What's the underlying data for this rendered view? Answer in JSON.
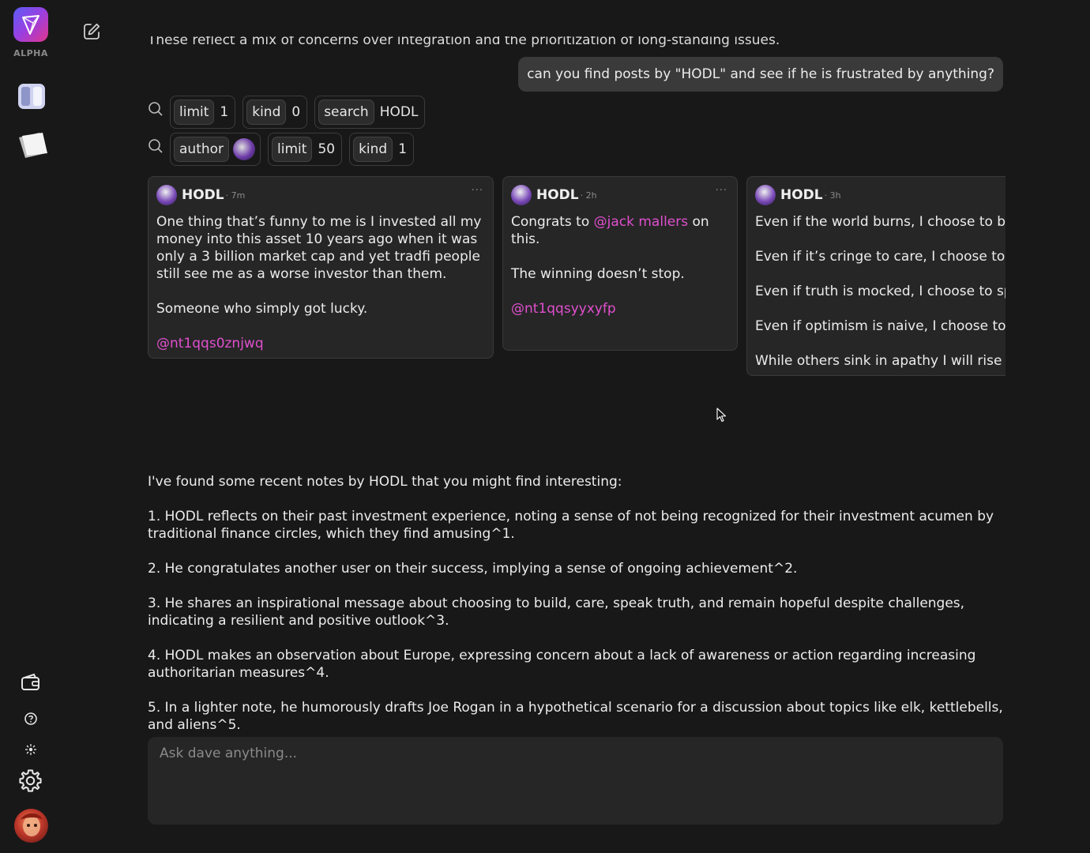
{
  "sidebar": {
    "logo_label": "ALPHA",
    "icons": [
      "app-logo-icon",
      "sidebar-toggle-icon",
      "notes-icon",
      "wallet-icon",
      "help-icon",
      "theme-icon",
      "settings-icon"
    ]
  },
  "conversation": {
    "previous_reply_tail": "These reflect a mix of concerns over integration and the prioritization of long-standing issues.",
    "user_message": "can you find posts by \"HODL\" and see if he is frustrated by anything?"
  },
  "tool_calls": [
    {
      "chips": [
        {
          "key": "limit",
          "value": "1"
        },
        {
          "key": "kind",
          "value": "0"
        },
        {
          "key": "search",
          "value": "HODL"
        }
      ]
    },
    {
      "chips": [
        {
          "key": "author",
          "value": ""
        },
        {
          "key": "limit",
          "value": "50"
        },
        {
          "key": "kind",
          "value": "1"
        }
      ]
    }
  ],
  "notes": [
    {
      "author": "HODL",
      "time": "7m",
      "body": "One thing that’s funny to me is I invested all my money into this asset 10 years ago when it was only a 3 billion market cap and yet tradfi people still see me as a worse investor than them.\n\nSomeone who simply got lucky.",
      "mention": "@nt1qqs0znjwq"
    },
    {
      "author": "HODL",
      "time": "2h",
      "body_pre": "Congrats to ",
      "inline_mention": "@jack mallers",
      "body_post": " on this.",
      "line2": "The winning doesn’t stop.",
      "mention": "@nt1qqsyyxyfp"
    },
    {
      "author": "HODL",
      "time": "3h",
      "lines": [
        "Even if the world burns, I choose to build.",
        "Even if it’s cringe to care, I choose to care.",
        "Even if truth is mocked, I choose to speak it.",
        "Even if optimism is naive, I choose to be hopeful.",
        "While others sink in apathy I will rise in action."
      ]
    }
  ],
  "answer": {
    "intro": "I've found some recent notes by HODL that you might find interesting:",
    "items": [
      "1. HODL reflects on their past investment experience, noting a sense of not being recognized for their investment acumen by traditional finance circles, which they find amusing^1.",
      "2. He congratulates another user on their success, implying a sense of ongoing achievement^2.",
      "3. He shares an inspirational message about choosing to build, care, speak truth, and remain hopeful despite challenges, indicating a resilient and positive outlook^3.",
      "4. HODL makes an observation about Europe, expressing concern about a lack of awareness or action regarding increasing authoritarian measures^4.",
      "5. In a lighter note, he humorously drafts Joe Rogan in a hypothetical scenario for a discussion about topics like elk, kettlebells, and aliens^5."
    ]
  },
  "composer": {
    "placeholder": "Ask dave anything..."
  },
  "colors": {
    "background": "#181818",
    "accent_mention": "#e04fce",
    "card_bg": "#262626",
    "bubble_bg": "#3a3a3a"
  }
}
